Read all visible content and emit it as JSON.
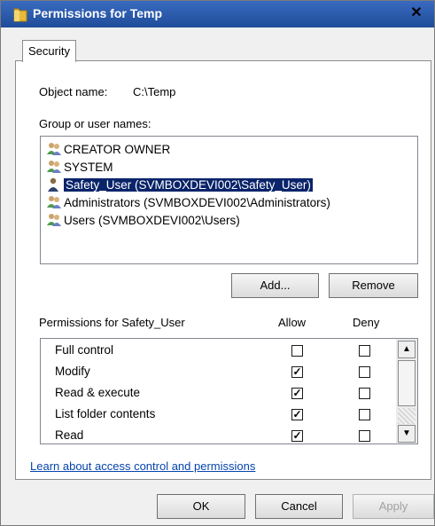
{
  "window": {
    "title": "Permissions for Temp",
    "close_label": "✕"
  },
  "tabs": [
    {
      "label": "Security"
    }
  ],
  "object": {
    "label": "Object name:",
    "value": "C:\\Temp"
  },
  "group_label": "Group or user names:",
  "users": [
    {
      "name": "CREATOR OWNER",
      "icon": "group-users-icon",
      "selected": false
    },
    {
      "name": "SYSTEM",
      "icon": "group-users-icon",
      "selected": false
    },
    {
      "name": "Safety_User (SVMBOXDEVI002\\Safety_User)",
      "icon": "single-user-icon",
      "selected": true
    },
    {
      "name": "Administrators (SVMBOXDEVI002\\Administrators)",
      "icon": "group-users-icon",
      "selected": false
    },
    {
      "name": "Users (SVMBOXDEVI002\\Users)",
      "icon": "group-users-icon",
      "selected": false
    }
  ],
  "buttons": {
    "add": "Add...",
    "remove": "Remove",
    "ok": "OK",
    "cancel": "Cancel",
    "apply": "Apply"
  },
  "permissions": {
    "header": "Permissions for Safety_User",
    "allow_label": "Allow",
    "deny_label": "Deny",
    "rows": [
      {
        "name": "Full control",
        "allow": false,
        "deny": false
      },
      {
        "name": "Modify",
        "allow": true,
        "deny": false
      },
      {
        "name": "Read & execute",
        "allow": true,
        "deny": false
      },
      {
        "name": "List folder contents",
        "allow": true,
        "deny": false
      },
      {
        "name": "Read",
        "allow": true,
        "deny": false
      }
    ]
  },
  "link_text": "Learn about access control and permissions",
  "colors": {
    "title_bar": "#2b59a6",
    "selection": "#0a246a",
    "link": "#0645ad"
  }
}
